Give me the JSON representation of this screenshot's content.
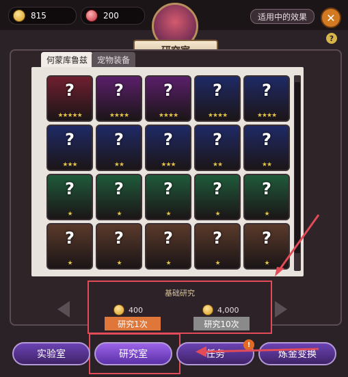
{
  "top": {
    "gold_value": "815",
    "gem_value": "200",
    "effects_label": "适用中的效果",
    "close_label": "✕",
    "help_label": "?",
    "title": "研究室"
  },
  "tabs": [
    {
      "label": "何蒙库鲁兹"
    },
    {
      "label": "宠物装备"
    }
  ],
  "cards": [
    {
      "bg": "#6f1f2f",
      "stars": "★★★★★"
    },
    {
      "bg": "#5a1f6a",
      "stars": "★★★★"
    },
    {
      "bg": "#5a1f6a",
      "stars": "★★★★"
    },
    {
      "bg": "#1f2a66",
      "stars": "★★★★"
    },
    {
      "bg": "#1f2a66",
      "stars": "★★★★"
    },
    {
      "bg": "#1f2a66",
      "stars": "★★★"
    },
    {
      "bg": "#1f2a66",
      "stars": "★★"
    },
    {
      "bg": "#1f2a66",
      "stars": "★★★"
    },
    {
      "bg": "#1f2a66",
      "stars": "★★"
    },
    {
      "bg": "#1f2a66",
      "stars": "★★"
    },
    {
      "bg": "#1f5a3a",
      "stars": "★"
    },
    {
      "bg": "#1f5a3a",
      "stars": "★"
    },
    {
      "bg": "#1f5a3a",
      "stars": "★"
    },
    {
      "bg": "#1f5a3a",
      "stars": "★"
    },
    {
      "bg": "#1f5a3a",
      "stars": "★"
    },
    {
      "bg": "#5a3a2a",
      "stars": "★"
    },
    {
      "bg": "#5a3a2a",
      "stars": "★"
    },
    {
      "bg": "#5a3a2a",
      "stars": "★"
    },
    {
      "bg": "#5a3a2a",
      "stars": "★"
    },
    {
      "bg": "#5a3a2a",
      "stars": "★"
    }
  ],
  "research": {
    "basic_label": "基础研究",
    "cost_one": "400",
    "cost_ten": "4,000",
    "button_one": "研究1次",
    "button_ten": "研究10次"
  },
  "nav": {
    "lab": "实验室",
    "research": "研究室",
    "task": "任务",
    "alchemy": "炼金变换",
    "badge": "!"
  },
  "colors": {
    "accent": "#e24b57",
    "gold": "#d59c1e",
    "purple": "#6b43b3"
  }
}
